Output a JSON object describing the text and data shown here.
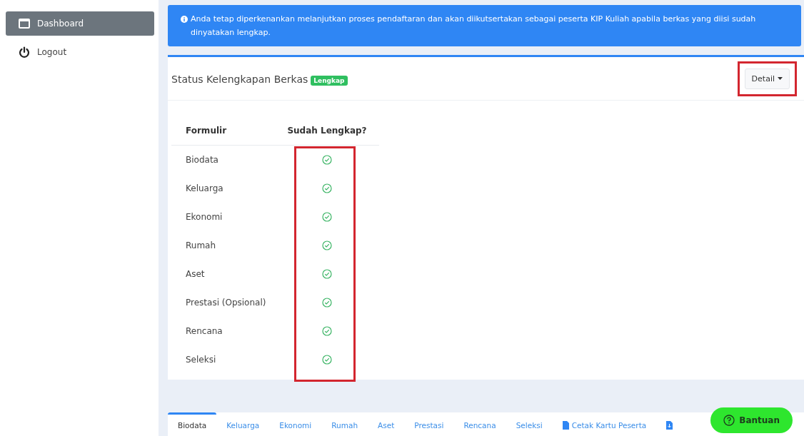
{
  "sidebar": {
    "items": [
      {
        "label": "Dashboard",
        "kind": "window",
        "selected": true
      },
      {
        "label": "Logout",
        "kind": "power",
        "selected": false
      }
    ]
  },
  "alert": {
    "text": "Anda tetap diperkenankan melanjutkan proses pendaftaran dan akan diikutsertakan sebagai peserta KIP Kuliah apabila berkas yang diisi sudah dinyatakan lengkap."
  },
  "card": {
    "title": "Status Kelengkapan Berkas",
    "badge": "Lengkap",
    "detail_button": {
      "label": "Detail",
      "highlighted": true
    }
  },
  "table": {
    "columns": [
      "Formulir",
      "Sudah Lengkap?"
    ],
    "check_column_highlighted": true,
    "rows": [
      {
        "name": "Biodata",
        "complete": true
      },
      {
        "name": "Keluarga",
        "complete": true
      },
      {
        "name": "Ekonomi",
        "complete": true
      },
      {
        "name": "Rumah",
        "complete": true
      },
      {
        "name": "Aset",
        "complete": true
      },
      {
        "name": "Prestasi (Opsional)",
        "complete": true
      },
      {
        "name": "Rencana",
        "complete": true
      },
      {
        "name": "Seleksi",
        "complete": true
      }
    ]
  },
  "tabs": [
    {
      "kind": "text",
      "label": "Biodata",
      "selected": true
    },
    {
      "kind": "text",
      "label": "Keluarga",
      "selected": false
    },
    {
      "kind": "text",
      "label": "Ekonomi",
      "selected": false
    },
    {
      "kind": "text",
      "label": "Rumah",
      "selected": false
    },
    {
      "kind": "text",
      "label": "Aset",
      "selected": false
    },
    {
      "kind": "text",
      "label": "Prestasi",
      "selected": false
    },
    {
      "kind": "text",
      "label": "Rencana",
      "selected": false
    },
    {
      "kind": "text",
      "label": "Seleksi",
      "selected": false
    },
    {
      "kind": "file",
      "label": "Cetak Kartu Peserta",
      "selected": false
    },
    {
      "kind": "download",
      "selected": false
    }
  ],
  "help_button": {
    "label": "Bantuan"
  }
}
